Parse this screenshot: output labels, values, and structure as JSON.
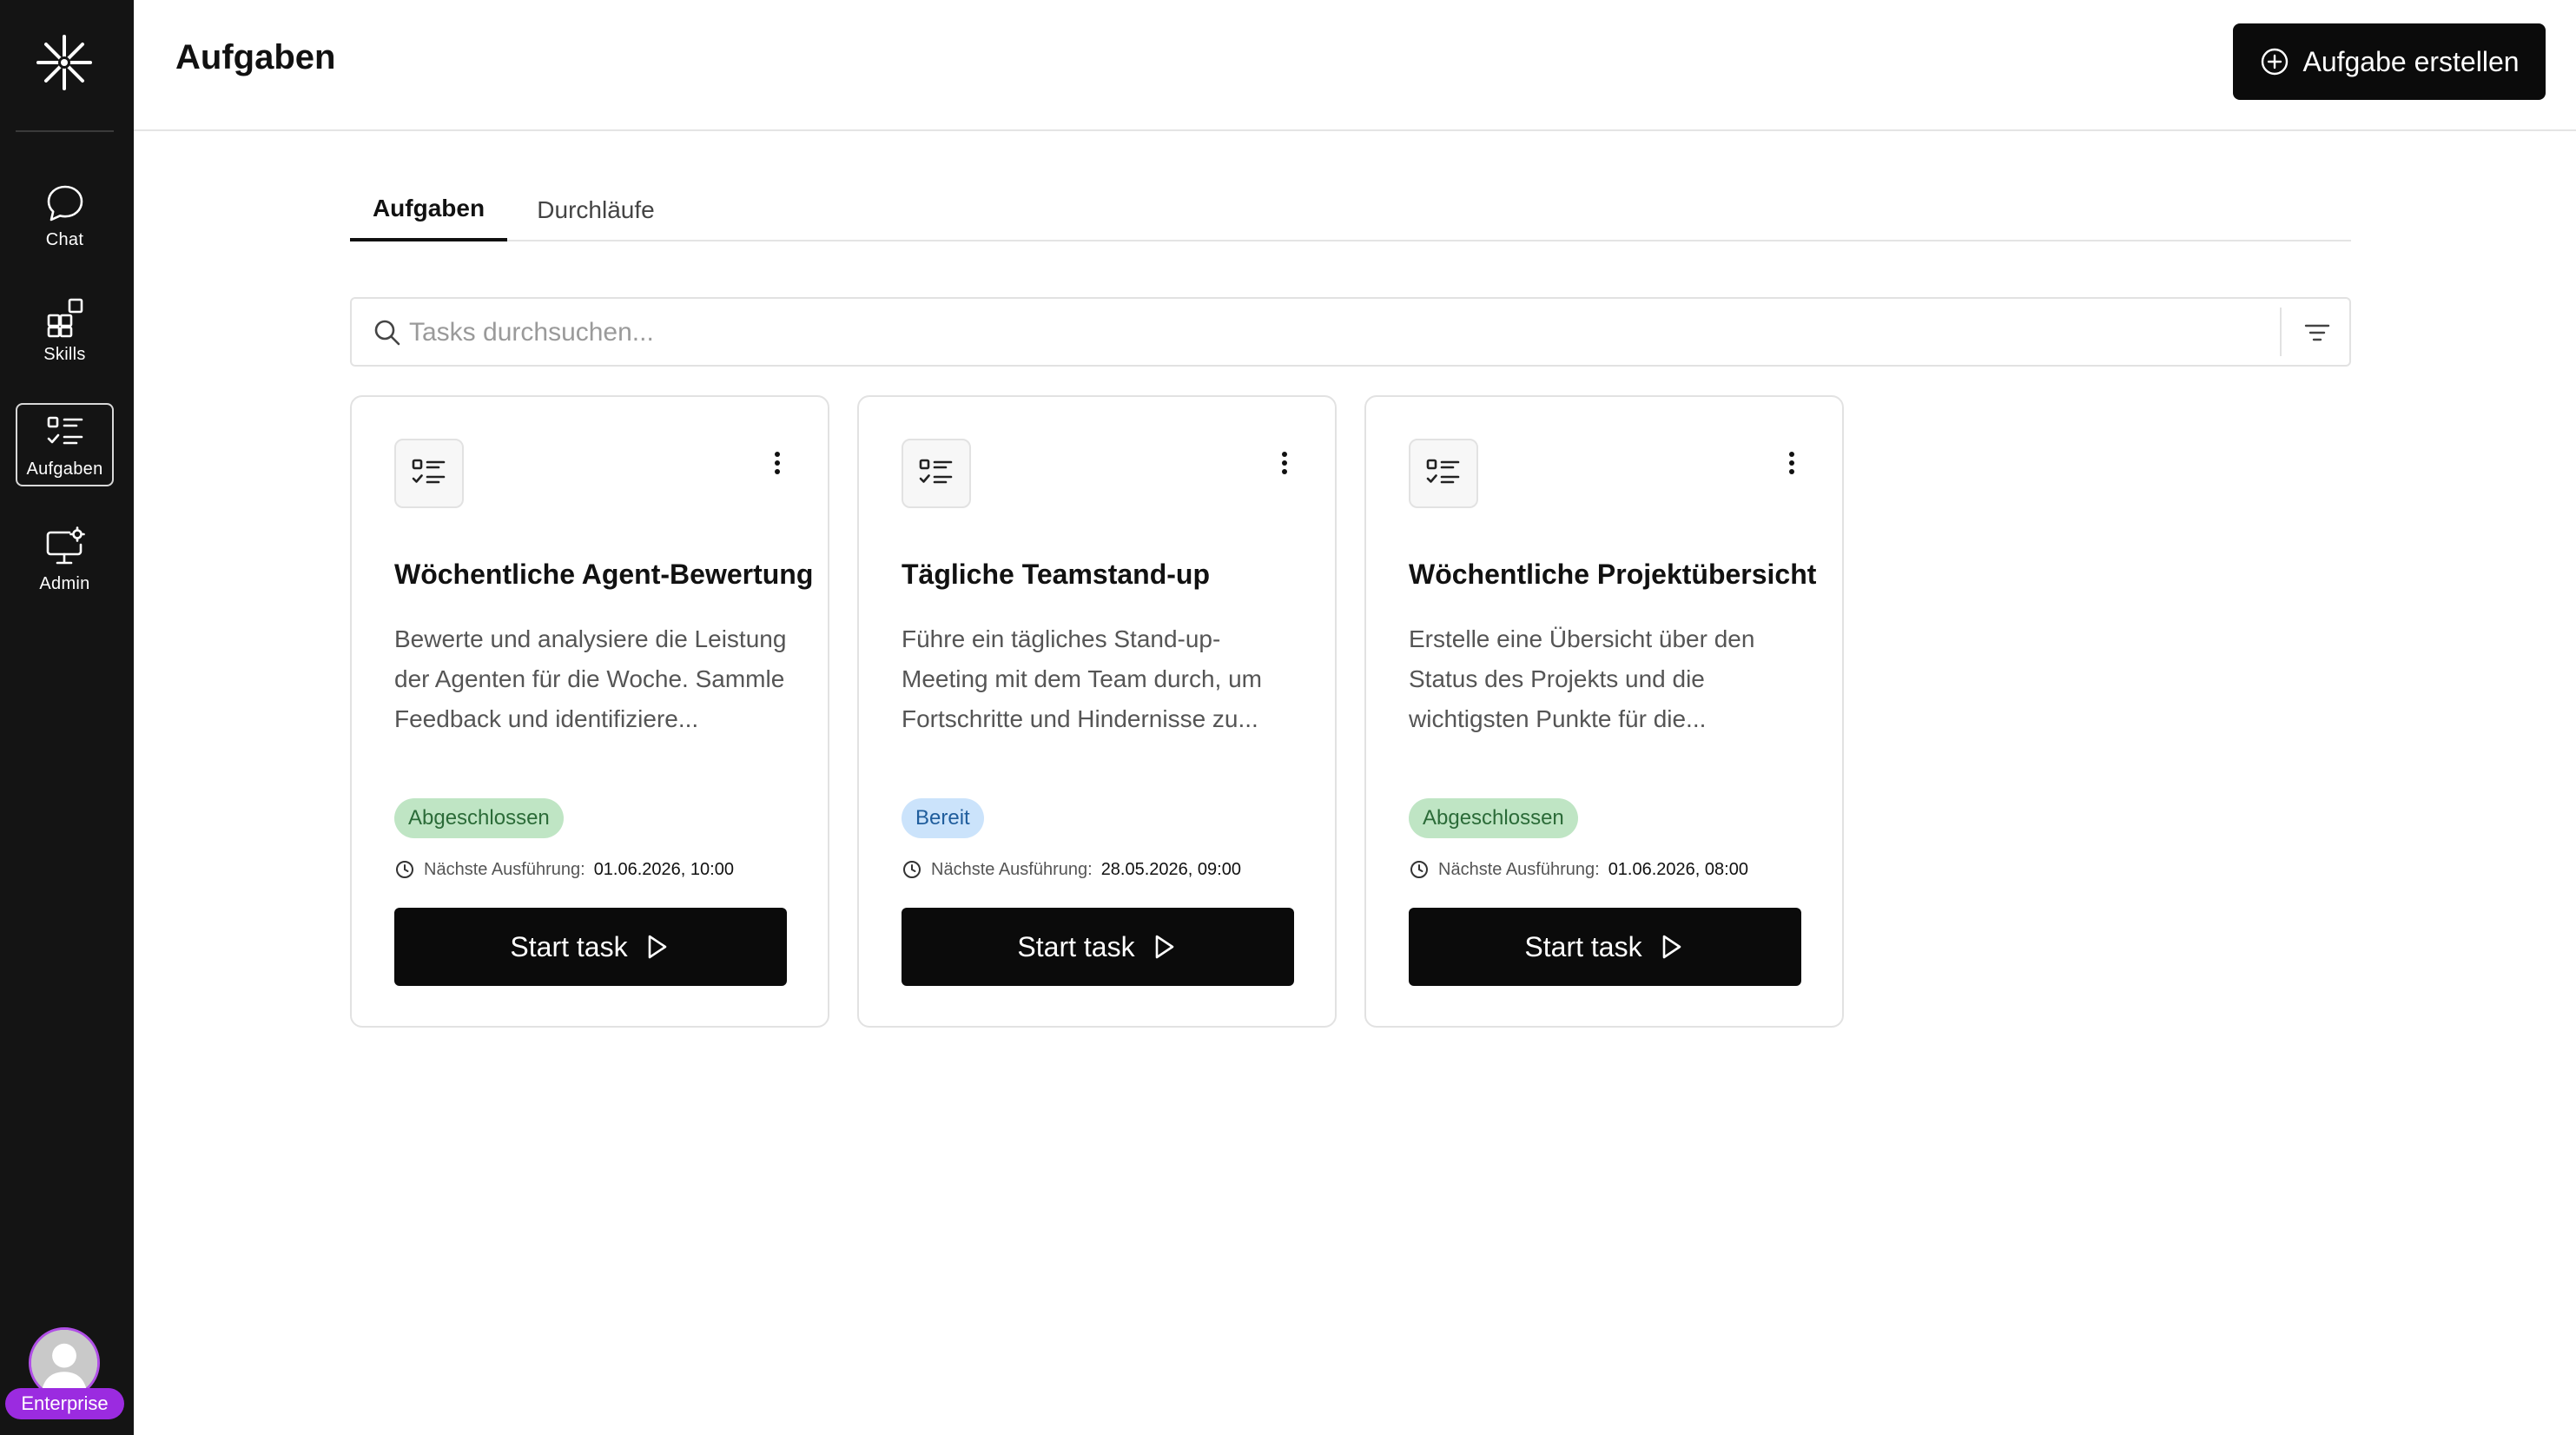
{
  "sidebar": {
    "items": [
      {
        "label": "Chat",
        "icon": "chat-bubble-icon"
      },
      {
        "label": "Skills",
        "icon": "skills-icon"
      },
      {
        "label": "Aufgaben",
        "icon": "task-list-icon",
        "active": true
      },
      {
        "label": "Admin",
        "icon": "admin-monitor-icon"
      }
    ],
    "plan_badge": "Enterprise"
  },
  "header": {
    "title": "Aufgaben",
    "create_button_label": "Aufgabe erstellen"
  },
  "tabs": [
    {
      "label": "Aufgaben",
      "active": true
    },
    {
      "label": "Durchläufe",
      "active": false
    }
  ],
  "search": {
    "placeholder": "Tasks durchsuchen...",
    "value": ""
  },
  "cards": [
    {
      "title": "Wöchentliche Agent-Bewertung",
      "description": "Bewerte und analysiere die Leistung der Agenten für die Woche. Sammle Feedback und identifiziere...",
      "status": "Abgeschlossen",
      "status_type": "done",
      "next_run_label": "Nächste Ausführung:",
      "next_run_value": "01.06.2026, 10:00",
      "start_label": "Start task"
    },
    {
      "title": "Tägliche Teamstand-up",
      "description": "Führe ein tägliches Stand-up-Meeting mit dem Team durch, um Fortschritte und Hindernisse zu...",
      "status": "Bereit",
      "status_type": "ready",
      "next_run_label": "Nächste Ausführung:",
      "next_run_value": "28.05.2026, 09:00",
      "start_label": "Start task"
    },
    {
      "title": "Wöchentliche Projektübersicht",
      "description": "Erstelle eine Übersicht über den Status des Projekts und die wichtigsten Punkte für die...",
      "status": "Abgeschlossen",
      "status_type": "done",
      "next_run_label": "Nächste Ausführung:",
      "next_run_value": "01.06.2026, 08:00",
      "start_label": "Start task"
    }
  ],
  "colors": {
    "sidebar_bg": "#141414",
    "primary_button": "#0b0b0b",
    "status_done_bg": "#bfe5c4",
    "status_ready_bg": "#cbe3fb",
    "enterprise_badge": "#9b2be0"
  }
}
